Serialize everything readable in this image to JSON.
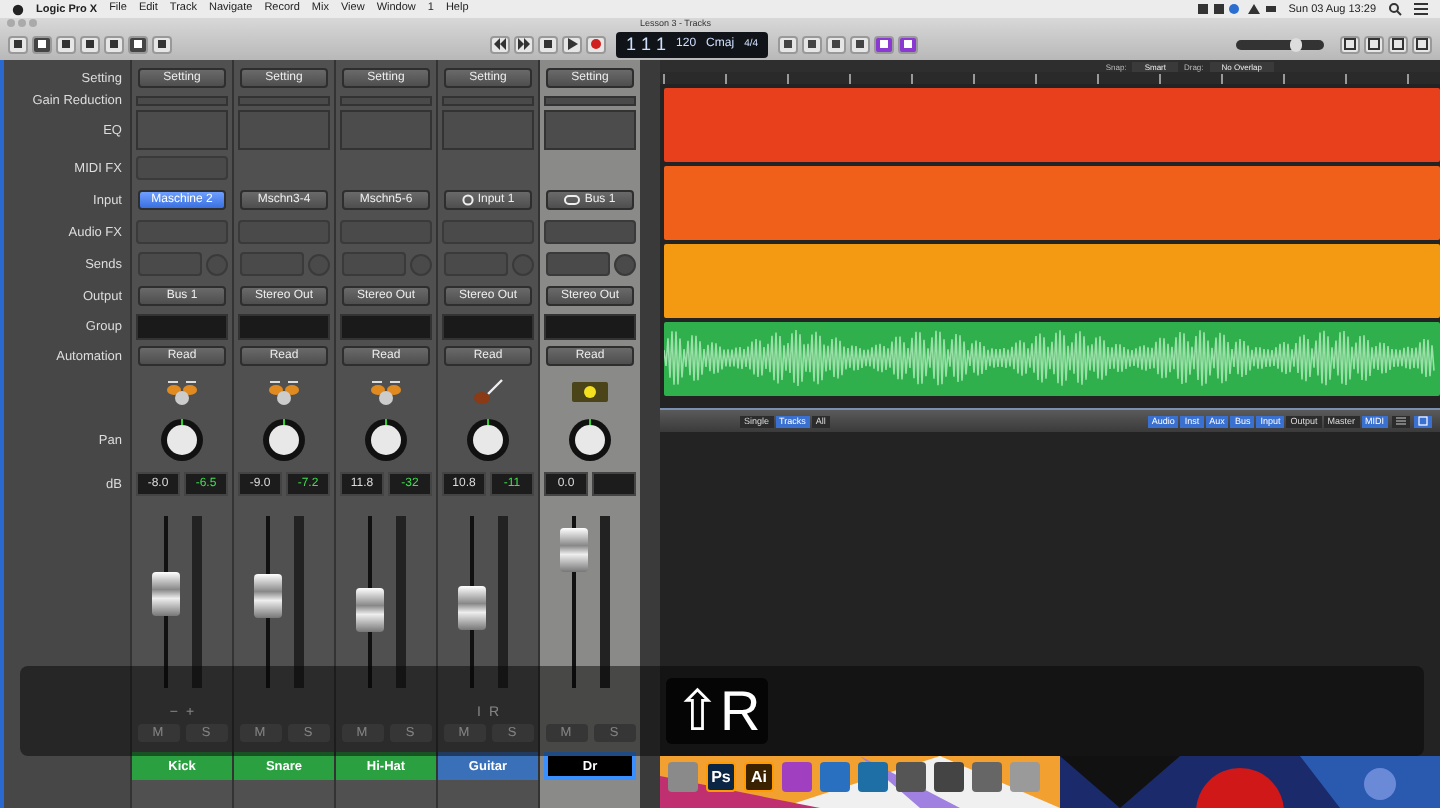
{
  "menu_bar": {
    "app": "Logic Pro X",
    "items": [
      "File",
      "Edit",
      "Track",
      "Navigate",
      "Record",
      "Mix",
      "View",
      "Window",
      "1",
      "Help"
    ],
    "clock": "Sun 03 Aug 13:29"
  },
  "window": {
    "title": "Lesson 3 - Tracks"
  },
  "lcd": {
    "position": "1 1 1",
    "tempo": "120",
    "key": "Cmaj",
    "signature": "4/4"
  },
  "master_volume": {
    "level": 0.72
  },
  "tracks_header": {
    "snap_label": "Snap:",
    "snap": "Smart",
    "drag_label": "Drag:",
    "drag": "No Overlap"
  },
  "regions": [
    {
      "kind": "plain",
      "color": "#e8401c"
    },
    {
      "kind": "plain",
      "color": "#f0601a"
    },
    {
      "kind": "plain",
      "color": "#f39a12"
    },
    {
      "kind": "waveform",
      "color": "#2fb04c"
    }
  ],
  "mixer_bar": {
    "views": [
      {
        "label": "Single",
        "selected": false
      },
      {
        "label": "Tracks",
        "selected": true
      },
      {
        "label": "All",
        "selected": false
      }
    ],
    "filters": [
      {
        "label": "Audio",
        "selected": true
      },
      {
        "label": "Inst",
        "selected": true
      },
      {
        "label": "Aux",
        "selected": true
      },
      {
        "label": "Bus",
        "selected": true
      },
      {
        "label": "Input",
        "selected": true
      },
      {
        "label": "Output",
        "selected": false
      },
      {
        "label": "Master",
        "selected": false
      },
      {
        "label": "MIDI",
        "selected": true
      }
    ]
  },
  "mixer": {
    "rows": [
      {
        "kind": "setting",
        "label": "Setting"
      },
      {
        "kind": "gain",
        "label": "Gain Reduction"
      },
      {
        "kind": "eq",
        "label": "EQ"
      },
      {
        "kind": "midifx",
        "label": "MIDI FX"
      },
      {
        "kind": "input",
        "label": "Input"
      },
      {
        "kind": "audiofx",
        "label": "Audio FX"
      },
      {
        "kind": "sends",
        "label": "Sends"
      },
      {
        "kind": "output",
        "label": "Output"
      },
      {
        "kind": "group",
        "label": "Group"
      },
      {
        "kind": "automation",
        "label": "Automation"
      },
      {
        "kind": "icon"
      },
      {
        "kind": "pan",
        "label": "Pan"
      },
      {
        "kind": "db",
        "label": "dB"
      }
    ],
    "strips": [
      {
        "kind": "drums",
        "selected": false,
        "setting": "Setting",
        "midi_fx": true,
        "input": "Maschine 2",
        "input_selected": true,
        "output": "Bus 1",
        "automation": "Read",
        "volume": "-8.0",
        "peak": "-6.5",
        "fader": {
          "level": 0.55
        },
        "extras": [
          "−",
          "+"
        ],
        "mute": "M",
        "solo": "S",
        "name": "Kick",
        "color": "#2aa040",
        "editing": false
      },
      {
        "kind": "drums",
        "selected": false,
        "setting": "Setting",
        "midi_fx": false,
        "input": "Mschn3-4",
        "input_selected": false,
        "output": "Stereo Out",
        "automation": "Read",
        "volume": "-9.0",
        "peak": "-7.2",
        "fader": {
          "level": 0.53
        },
        "mute": "M",
        "solo": "S",
        "name": "Snare",
        "color": "#2aa040",
        "editing": false
      },
      {
        "kind": "drums",
        "selected": false,
        "setting": "Setting",
        "midi_fx": false,
        "input": "Mschn5-6",
        "input_selected": false,
        "output": "Stereo Out",
        "automation": "Read",
        "volume": "11.8",
        "peak": "-32",
        "fader": {
          "level": 0.45
        },
        "mute": "M",
        "solo": "S",
        "name": "Hi-Hat",
        "color": "#2aa040",
        "editing": false
      },
      {
        "kind": "guitar",
        "selected": false,
        "setting": "Setting",
        "midi_fx": false,
        "input": "Input 1",
        "input_selected": false,
        "output": "Stereo Out",
        "automation": "Read",
        "volume": "10.8",
        "peak": "-11",
        "fader": {
          "level": 0.47
        },
        "extras": [
          "I",
          "R"
        ],
        "mute": "M",
        "solo": "S",
        "name": "Guitar",
        "color": "#3a70b8",
        "editing": false
      },
      {
        "kind": "aux",
        "selected": true,
        "setting": "Setting",
        "midi_fx": false,
        "input": "Bus 1",
        "input_selected": false,
        "output": "Stereo Out",
        "automation": "Read",
        "volume": "0.0",
        "fader": {
          "level": 0.8
        },
        "mute": "M",
        "solo": "S",
        "name": "Dr",
        "editing": true
      }
    ]
  },
  "overlay": {
    "keys": "⇧R"
  },
  "dock": {
    "items": [
      {
        "kind": "tile",
        "color": "#8a8a8a"
      },
      {
        "kind": "glyph",
        "label": "Ps",
        "color": "#0b2545"
      },
      {
        "kind": "glyph",
        "label": "Ai",
        "color": "#3a2200"
      },
      {
        "kind": "tile",
        "color": "#a040c0"
      },
      {
        "kind": "tile",
        "color": "#2a70c0"
      },
      {
        "kind": "tile",
        "color": "#1d6fa5"
      },
      {
        "kind": "tile",
        "color": "#555555"
      },
      {
        "kind": "tile",
        "color": "#444444"
      },
      {
        "kind": "tile",
        "color": "#666666"
      },
      {
        "kind": "tile",
        "color": "#9a9a9a"
      }
    ]
  }
}
